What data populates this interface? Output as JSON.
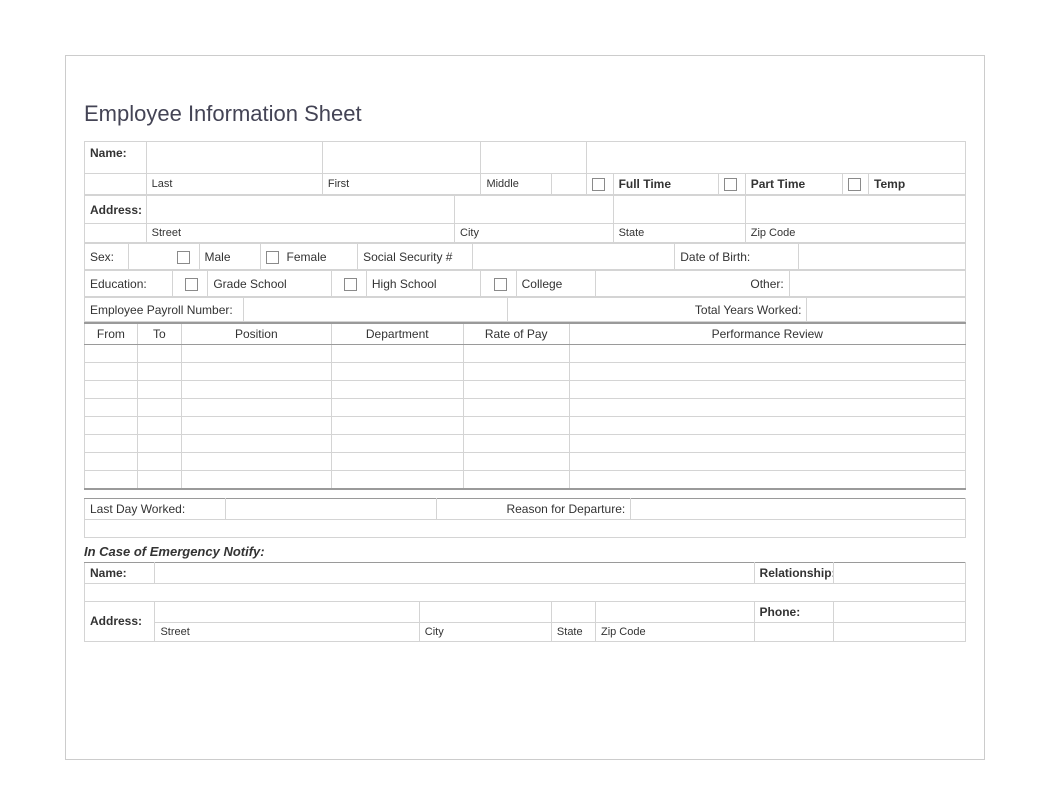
{
  "title": "Employee Information Sheet",
  "name": {
    "label": "Name:",
    "last_sub": "Last",
    "first_sub": "First",
    "middle_sub": "Middle",
    "full_time": "Full Time",
    "part_time": "Part Time",
    "temp": "Temp"
  },
  "address": {
    "label": "Address:",
    "street_sub": "Street",
    "city_sub": "City",
    "state_sub": "State",
    "zip_sub": "Zip Code"
  },
  "sex": {
    "label": "Sex:",
    "male": "Male",
    "female": "Female"
  },
  "ssn": {
    "label": "Social Security #"
  },
  "dob": {
    "label": "Date of Birth:"
  },
  "education": {
    "label": "Education:",
    "grade": "Grade School",
    "high": "High School",
    "college": "College",
    "other": "Other:"
  },
  "payroll": {
    "label": "Employee Payroll Number:"
  },
  "years": {
    "label": "Total Years Worked:"
  },
  "history": {
    "from": "From",
    "to": "To",
    "position": "Position",
    "department": "Department",
    "rate": "Rate of Pay",
    "review": "Performance Review"
  },
  "departure": {
    "last_day": "Last Day Worked:",
    "reason": "Reason for Departure:"
  },
  "emergency": {
    "title": "In Case of Emergency Notify:",
    "name": "Name:",
    "relationship": "Relationship:",
    "address": "Address:",
    "street": "Street",
    "city": "City",
    "state": "State",
    "zip": "Zip Code",
    "phone": "Phone:"
  }
}
